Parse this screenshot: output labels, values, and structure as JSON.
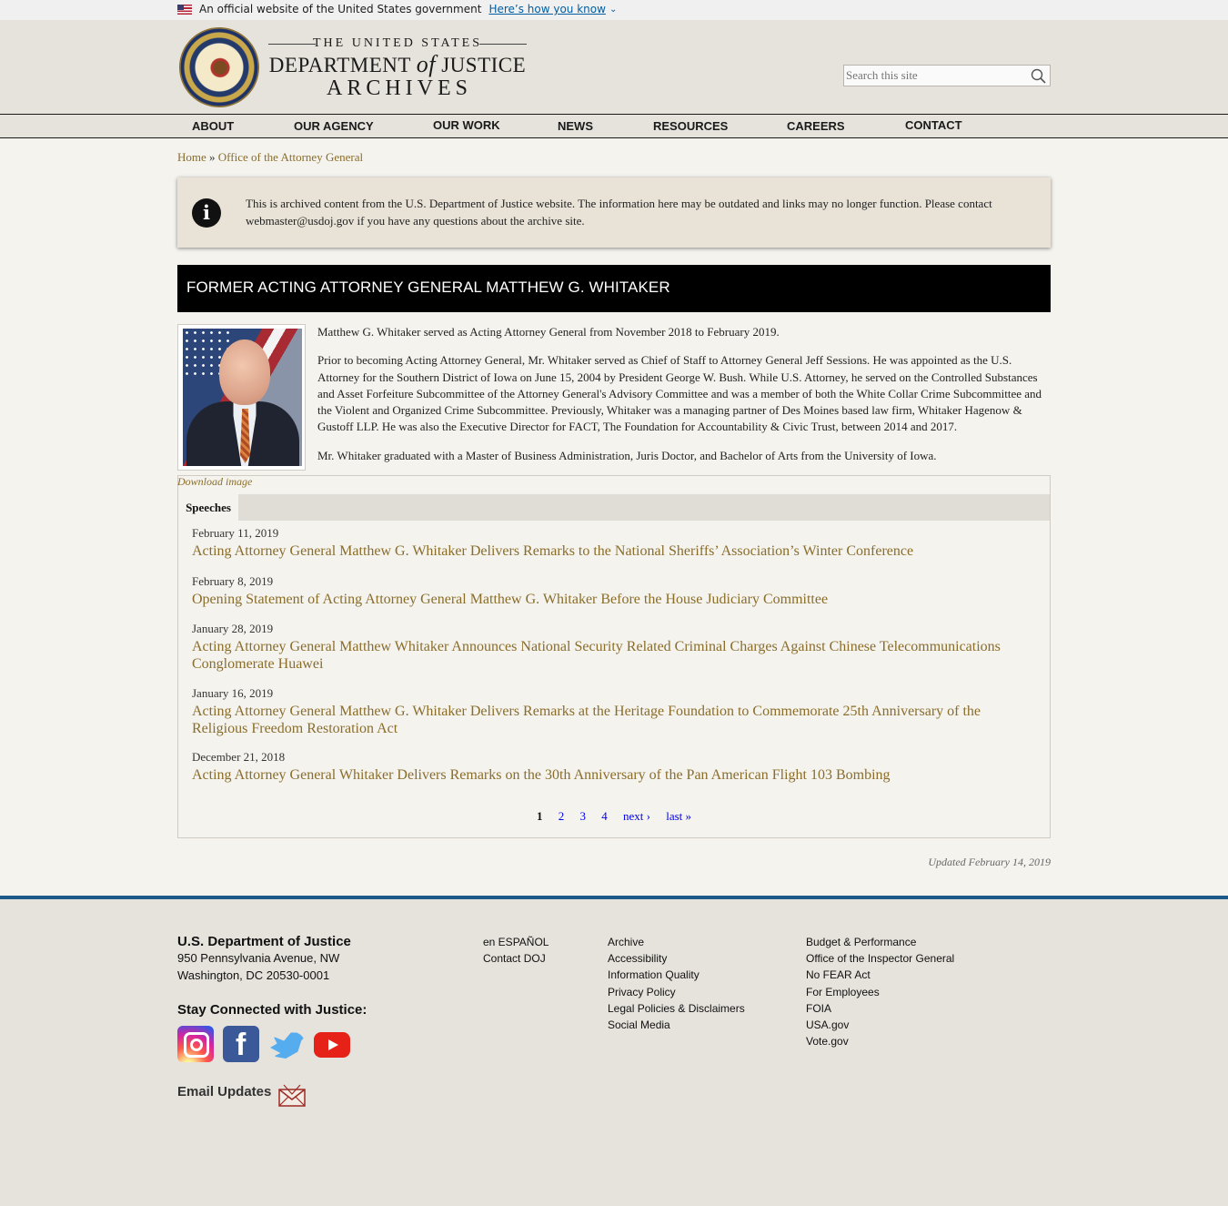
{
  "gov_banner": {
    "text": "An official website of the United States government",
    "link": "Here’s how you know"
  },
  "header": {
    "wordmark_line1": "THE UNITED STATES",
    "wordmark_line2_a": "DEPARTMENT",
    "wordmark_line2_of": "of",
    "wordmark_line2_b": "JUSTICE",
    "wordmark_line3": "ARCHIVES",
    "search_placeholder": "Search this site"
  },
  "nav": [
    "ABOUT",
    "OUR AGENCY",
    "OUR WORK",
    "NEWS",
    "RESOURCES",
    "CAREERS",
    "CONTACT"
  ],
  "breadcrumb": {
    "home": "Home",
    "sep": "»",
    "current": "Office of the Attorney General"
  },
  "notice": "This is archived content from the U.S. Department of Justice website. The information here may be outdated and links may no longer function. Please contact webmaster@usdoj.gov if you have any questions about the archive site.",
  "page_title": "FORMER ACTING ATTORNEY GENERAL MATTHEW G. WHITAKER",
  "bio": [
    "Matthew G. Whitaker served as Acting Attorney General from November 2018 to February 2019.",
    "Prior to becoming Acting Attorney General, Mr. Whitaker served as Chief of Staff to Attorney General Jeff Sessions. He was appointed as the U.S. Attorney for the Southern District of Iowa on June 15, 2004 by President George W. Bush. While U.S. Attorney, he served on the Controlled Substances and Asset Forfeiture Subcommittee of the Attorney General's Advisory Committee and was a member of both the White Collar Crime Subcommittee and the Violent and Organized Crime Subcommittee. Previously, Whitaker was a managing partner of Des Moines based law firm, Whitaker Hagenow & Gustoff LLP. He was also the Executive Director for FACT, The Foundation for Accountability & Civic Trust, between 2014 and 2017.",
    "Mr. Whitaker graduated with a Master of Business Administration, Juris Doctor, and Bachelor of Arts from the University of Iowa."
  ],
  "download_image": "Download image",
  "tab_label": "Speeches",
  "speeches": [
    {
      "date": "February 11, 2019",
      "title": "Acting Attorney General Matthew G. Whitaker Delivers Remarks to the National Sheriffs’ Association’s Winter Conference"
    },
    {
      "date": "February 8, 2019",
      "title": "Opening Statement of Acting Attorney General Matthew G. Whitaker Before the House Judiciary Committee"
    },
    {
      "date": "January 28, 2019",
      "title": "Acting Attorney General Matthew Whitaker Announces National Security Related Criminal Charges Against Chinese Telecommunications Conglomerate Huawei"
    },
    {
      "date": "January 16, 2019",
      "title": "Acting Attorney General Matthew G. Whitaker Delivers Remarks at the Heritage Foundation to Commemorate 25th Anniversary of the Religious Freedom Restoration Act"
    },
    {
      "date": "December 21, 2018",
      "title": "Acting Attorney General Whitaker Delivers Remarks on the 30th Anniversary of the Pan American Flight 103 Bombing"
    }
  ],
  "pager": {
    "current": "1",
    "pages": [
      "2",
      "3",
      "4"
    ],
    "next": "next ›",
    "last": "last »"
  },
  "updated": "Updated February 14, 2019",
  "footer": {
    "org": "U.S. Department of Justice",
    "address1": "950 Pennsylvania Avenue, NW",
    "address2": "Washington, DC 20530-0001",
    "stay": "Stay Connected with Justice:",
    "email": "Email Updates",
    "col1": [
      "en ESPAÑOL",
      "Contact DOJ"
    ],
    "col2": [
      "Archive",
      "Accessibility",
      "Information Quality",
      "Privacy Policy",
      "Legal Policies & Disclaimers",
      "Social Media"
    ],
    "col3": [
      "Budget & Performance",
      "Office of the Inspector General",
      "No FEAR Act",
      "For Employees",
      "FOIA",
      "USA.gov",
      "Vote.gov"
    ]
  },
  "colors": {
    "link": "#8a6d2b",
    "title_bar": "#000000",
    "footer_rule": "#1c5a8a",
    "gov_link": "#005ea2"
  }
}
